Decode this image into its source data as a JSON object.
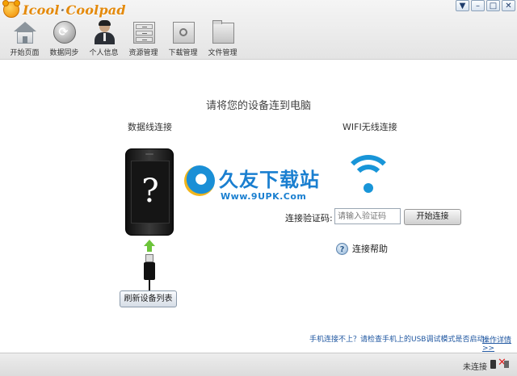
{
  "app": {
    "logo_part1": "Icool",
    "logo_dot": "·",
    "logo_part2": "Coolpad"
  },
  "window_controls": {
    "menu": "▼",
    "minimize": "–",
    "maximize": "□",
    "close": "✕"
  },
  "nav": [
    {
      "label": "开始页面",
      "icon": "home-icon"
    },
    {
      "label": "数据同步",
      "icon": "sync-icon"
    },
    {
      "label": "个人信息",
      "icon": "person-icon"
    },
    {
      "label": "资源管理",
      "icon": "cabinet-icon"
    },
    {
      "label": "下载管理",
      "icon": "safe-icon"
    },
    {
      "label": "文件管理",
      "icon": "folder-icon"
    }
  ],
  "main": {
    "headline": "请将您的设备连到电脑",
    "usb_title": "数据线连接",
    "wifi_title": "WIFI无线连接",
    "phone_symbol": "?",
    "refresh_button": "刷新设备列表",
    "code_label": "连接验证码:",
    "code_placeholder": "请输入验证码",
    "start_button": "开始连接",
    "help_symbol": "?",
    "help_text": "连接帮助",
    "hint": "手机连接不上？请检查手机上的USB调试模式是否启动!",
    "details_link": "操作详情>>"
  },
  "watermark": {
    "title": "久友下载站",
    "url": "Www.9UPK.Com"
  },
  "status": {
    "text": "未连接",
    "x_symbol": "✕"
  },
  "colors": {
    "accent_blue": "#1895d8",
    "logo_orange": "#e48a0c",
    "arrow_green": "#6cc43a"
  }
}
